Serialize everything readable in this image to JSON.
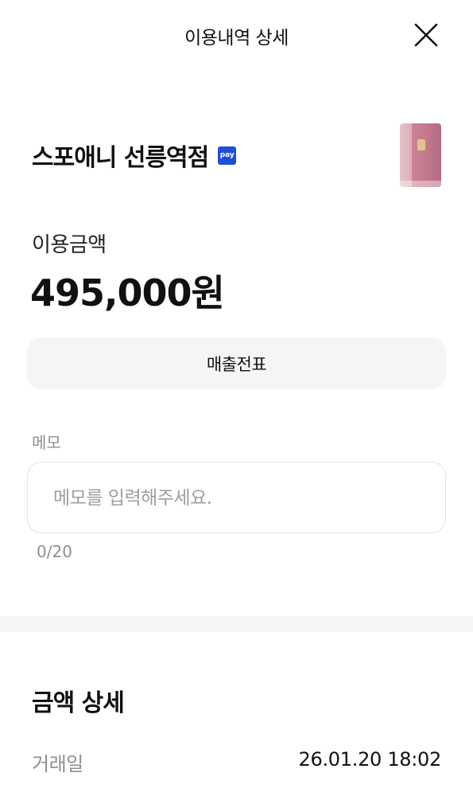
{
  "header": {
    "title": "이용내역 상세",
    "close_icon": "close-icon"
  },
  "merchant": {
    "name": "스포애니 선릉역점",
    "badge": "pay",
    "badge_color": "#1f4fd6",
    "card_image": "card-thumbnail"
  },
  "amount": {
    "label": "이용금액",
    "value": "495,000원"
  },
  "receipt_button": {
    "label": "매출전표"
  },
  "memo": {
    "label": "메모",
    "value": "",
    "placeholder": "메모를 입력해주세요.",
    "counter": "0/20"
  },
  "amount_detail": {
    "title": "금액 상세",
    "rows": [
      {
        "label": "거래일",
        "value": "26.01.20 18:02"
      }
    ]
  }
}
